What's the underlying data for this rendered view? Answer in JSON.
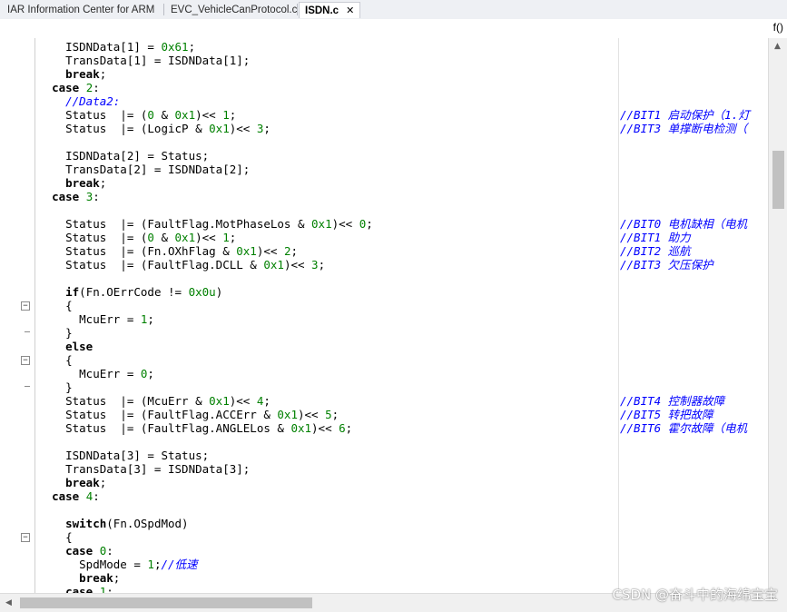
{
  "tabs": [
    {
      "label": "IAR Information Center for ARM"
    },
    {
      "label": "EVC_VehicleCanProtocol.c"
    },
    {
      "label": "ISDN.c",
      "close": "✕"
    }
  ],
  "toolbar": {
    "function_icon": "f()"
  },
  "code_lines": [
    {
      "segs": [
        [
          "    ISDNData[1] = ",
          ""
        ],
        [
          "0x61",
          "num"
        ],
        [
          ";",
          ""
        ]
      ]
    },
    {
      "segs": [
        [
          "    TransData[1] = ISDNData[1];",
          ""
        ]
      ]
    },
    {
      "segs": [
        [
          "    ",
          "",
          ""
        ],
        [
          "break",
          "kw"
        ],
        [
          ";",
          ""
        ]
      ]
    },
    {
      "segs": [
        [
          "  ",
          ""
        ],
        [
          "case",
          "kw"
        ],
        [
          " ",
          ""
        ],
        [
          "2",
          "num"
        ],
        [
          ":",
          ""
        ]
      ]
    },
    {
      "segs": [
        [
          "    ",
          ""
        ],
        [
          "//Data2:",
          "com"
        ]
      ]
    },
    {
      "segs": [
        [
          "    Status  |= (",
          ""
        ],
        [
          "0",
          "num"
        ],
        [
          " & ",
          ""
        ],
        [
          "0x1",
          "num"
        ],
        [
          ")<< ",
          ""
        ],
        [
          "1",
          "num"
        ],
        [
          ";",
          ""
        ]
      ],
      "comment": "//BIT1 启动保护（1.灯"
    },
    {
      "segs": [
        [
          "    Status  |= (LogicP & ",
          ""
        ],
        [
          "0x1",
          "num"
        ],
        [
          ")<< ",
          ""
        ],
        [
          "3",
          "num"
        ],
        [
          ";",
          ""
        ]
      ],
      "comment": "//BIT3 单撑断电检测（"
    },
    {
      "segs": [
        [
          "",
          ""
        ]
      ]
    },
    {
      "segs": [
        [
          "    ISDNData[2] = Status;",
          ""
        ]
      ]
    },
    {
      "segs": [
        [
          "    TransData[2] = ISDNData[2];",
          ""
        ]
      ]
    },
    {
      "segs": [
        [
          "    ",
          ""
        ],
        [
          "break",
          "kw"
        ],
        [
          ";",
          ""
        ]
      ]
    },
    {
      "segs": [
        [
          "  ",
          ""
        ],
        [
          "case",
          "kw"
        ],
        [
          " ",
          ""
        ],
        [
          "3",
          "num"
        ],
        [
          ":",
          ""
        ]
      ]
    },
    {
      "segs": [
        [
          "",
          ""
        ]
      ]
    },
    {
      "segs": [
        [
          "    Status  |= (FaultFlag.MotPhaseLos & ",
          ""
        ],
        [
          "0x1",
          "num"
        ],
        [
          ")<< ",
          ""
        ],
        [
          "0",
          "num"
        ],
        [
          ";",
          ""
        ]
      ],
      "comment": "//BIT0 电机缺相（电机"
    },
    {
      "segs": [
        [
          "    Status  |= (",
          ""
        ],
        [
          "0",
          "num"
        ],
        [
          " & ",
          ""
        ],
        [
          "0x1",
          "num"
        ],
        [
          ")<< ",
          ""
        ],
        [
          "1",
          "num"
        ],
        [
          ";",
          ""
        ]
      ],
      "comment": "//BIT1 助力"
    },
    {
      "segs": [
        [
          "    Status  |= (Fn.OXhFlag & ",
          ""
        ],
        [
          "0x1",
          "num"
        ],
        [
          ")<< ",
          ""
        ],
        [
          "2",
          "num"
        ],
        [
          ";",
          ""
        ]
      ],
      "comment": "//BIT2 巡航"
    },
    {
      "segs": [
        [
          "    Status  |= (FaultFlag.DCLL & ",
          ""
        ],
        [
          "0x1",
          "num"
        ],
        [
          ")<< ",
          ""
        ],
        [
          "3",
          "num"
        ],
        [
          ";",
          ""
        ]
      ],
      "comment": "//BIT3 欠压保护"
    },
    {
      "segs": [
        [
          "",
          ""
        ]
      ]
    },
    {
      "segs": [
        [
          "    ",
          ""
        ],
        [
          "if",
          "kw"
        ],
        [
          "(Fn.OErrCode != ",
          ""
        ],
        [
          "0x0u",
          "num"
        ],
        [
          ")",
          ""
        ]
      ]
    },
    {
      "segs": [
        [
          "    {",
          ""
        ]
      ]
    },
    {
      "segs": [
        [
          "      McuErr = ",
          ""
        ],
        [
          "1",
          "num"
        ],
        [
          ";",
          ""
        ]
      ]
    },
    {
      "segs": [
        [
          "    }",
          ""
        ]
      ]
    },
    {
      "segs": [
        [
          "    ",
          ""
        ],
        [
          "else",
          "kw"
        ]
      ]
    },
    {
      "segs": [
        [
          "    {",
          ""
        ]
      ]
    },
    {
      "segs": [
        [
          "      McuErr = ",
          ""
        ],
        [
          "0",
          "num"
        ],
        [
          ";",
          ""
        ]
      ]
    },
    {
      "segs": [
        [
          "    }",
          ""
        ]
      ]
    },
    {
      "segs": [
        [
          "    Status  |= (McuErr & ",
          ""
        ],
        [
          "0x1",
          "num"
        ],
        [
          ")<< ",
          ""
        ],
        [
          "4",
          "num"
        ],
        [
          ";",
          ""
        ]
      ],
      "comment": "//BIT4 控制器故障"
    },
    {
      "segs": [
        [
          "    Status  |= (FaultFlag.ACCErr & ",
          ""
        ],
        [
          "0x1",
          "num"
        ],
        [
          ")<< ",
          ""
        ],
        [
          "5",
          "num"
        ],
        [
          ";",
          ""
        ]
      ],
      "comment": "//BIT5 转把故障"
    },
    {
      "segs": [
        [
          "    Status  |= (FaultFlag.ANGLELos & ",
          ""
        ],
        [
          "0x1",
          "num"
        ],
        [
          ")<< ",
          ""
        ],
        [
          "6",
          "num"
        ],
        [
          ";",
          ""
        ]
      ],
      "comment": "//BIT6 霍尔故障（电机"
    },
    {
      "segs": [
        [
          "",
          ""
        ]
      ]
    },
    {
      "segs": [
        [
          "    ISDNData[3] = Status;",
          ""
        ]
      ]
    },
    {
      "segs": [
        [
          "    TransData[3] = ISDNData[3];",
          ""
        ]
      ]
    },
    {
      "segs": [
        [
          "    ",
          ""
        ],
        [
          "break",
          "kw"
        ],
        [
          ";",
          ""
        ]
      ]
    },
    {
      "segs": [
        [
          "  ",
          ""
        ],
        [
          "case",
          "kw"
        ],
        [
          " ",
          ""
        ],
        [
          "4",
          "num"
        ],
        [
          ":",
          ""
        ]
      ]
    },
    {
      "segs": [
        [
          "",
          ""
        ]
      ]
    },
    {
      "segs": [
        [
          "    ",
          ""
        ],
        [
          "switch",
          "kw"
        ],
        [
          "(Fn.OSpdMod)",
          ""
        ]
      ]
    },
    {
      "segs": [
        [
          "    {",
          ""
        ]
      ]
    },
    {
      "segs": [
        [
          "    ",
          ""
        ],
        [
          "case",
          "kw"
        ],
        [
          " ",
          ""
        ],
        [
          "0",
          "num"
        ],
        [
          ":",
          ""
        ]
      ]
    },
    {
      "segs": [
        [
          "      SpdMode = ",
          ""
        ],
        [
          "1",
          "num"
        ],
        [
          ";",
          ""
        ],
        [
          "//低速",
          "com"
        ]
      ]
    },
    {
      "segs": [
        [
          "      ",
          ""
        ],
        [
          "break",
          "kw"
        ],
        [
          ";",
          ""
        ]
      ]
    },
    {
      "segs": [
        [
          "    ",
          ""
        ],
        [
          "case",
          "kw"
        ],
        [
          " ",
          ""
        ],
        [
          "1",
          "num"
        ],
        [
          ":",
          ""
        ]
      ]
    }
  ],
  "watermark": "CSDN @奋斗中的海绵宝宝"
}
